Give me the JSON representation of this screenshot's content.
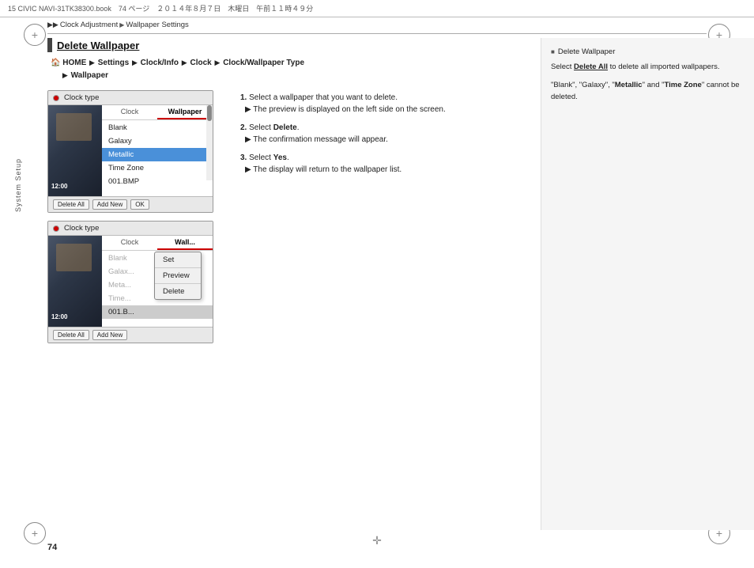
{
  "header": {
    "text": "15 CIVIC NAVI-31TK38300.book　74 ページ　２０１４年８月７日　木曜日　午前１１時４９分"
  },
  "breadcrumb": {
    "items": [
      "Clock Adjustment",
      "Wallpaper Settings"
    ]
  },
  "side_label": "System Setup",
  "section": {
    "title_prefix": "Delete ",
    "title_main": "Wallpaper"
  },
  "nav_path": {
    "home": "HOME",
    "arrow": "▶",
    "steps": [
      "Settings",
      "Clock/Info",
      "Clock",
      "Clock/Wallpaper Type",
      "Wallpaper"
    ]
  },
  "screenshot1": {
    "header_label": "Clock type",
    "tabs": [
      "Clock",
      "Wallpaper"
    ],
    "active_tab": "Wallpaper",
    "items": [
      "Blank",
      "Galaxy",
      "Metallic",
      "Time Zone",
      "001.BMP"
    ],
    "selected_item": "Metallic",
    "footer_buttons": [
      "Delete All",
      "Add New",
      "OK"
    ]
  },
  "screenshot2": {
    "header_label": "Clock type",
    "tabs": [
      "Clock",
      "Wallpaper"
    ],
    "items_short": [
      "Blank",
      "Galax",
      "Meta",
      "Time"
    ],
    "file_item": "001.B",
    "context_menu": [
      "Set",
      "Preview",
      "Delete"
    ]
  },
  "steps": [
    {
      "number": "1.",
      "text": "Select a wallpaper that you want to delete.",
      "sub": "The preview is displayed on the left side on the screen."
    },
    {
      "number": "2.",
      "text": "Select Delete.",
      "sub": "The confirmation message will appear."
    },
    {
      "number": "3.",
      "text": "Select Yes.",
      "sub": "The display will return to the wallpaper list."
    }
  ],
  "panel": {
    "title": "Delete Wallpaper",
    "text1": "Select Delete All to delete all imported wallpapers.",
    "text2_pre": "“Blank”, “Galaxy”, “",
    "text2_bold": "Metallic",
    "text2_mid": "” and “",
    "text2_bold2": "Time Zone",
    "text2_end": "” cannot be deleted."
  },
  "page_number": "74"
}
